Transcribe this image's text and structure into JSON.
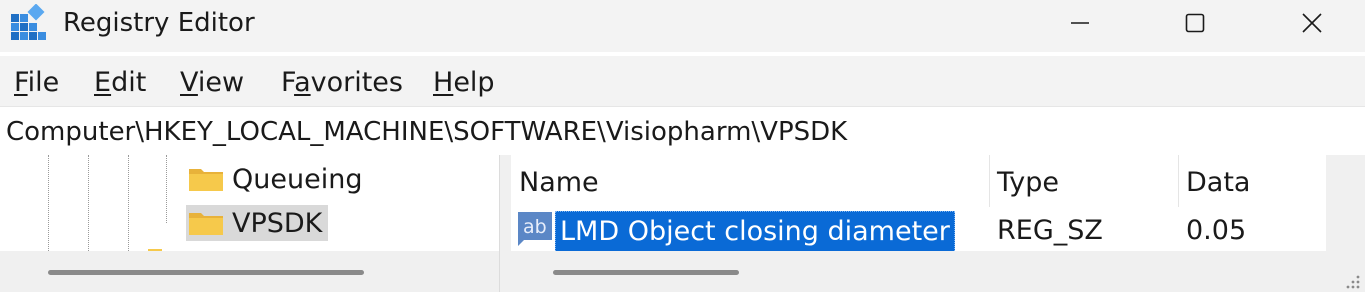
{
  "window": {
    "title": "Registry Editor",
    "icon": "registry-editor-icon"
  },
  "window_controls": {
    "minimize": "minimize-icon",
    "maximize": "maximize-icon",
    "close": "close-icon"
  },
  "menu": [
    {
      "accel": "F",
      "rest": "ile"
    },
    {
      "accel": "E",
      "rest": "dit"
    },
    {
      "accel": "V",
      "rest": "iew"
    },
    {
      "pre": "F",
      "accel": "a",
      "rest": "vorites"
    },
    {
      "accel": "H",
      "rest": "elp"
    }
  ],
  "address": "Computer\\HKEY_LOCAL_MACHINE\\SOFTWARE\\Visiopharm\\VPSDK",
  "tree": {
    "items": [
      {
        "label": "Queueing",
        "selected": false
      },
      {
        "label": "VPSDK",
        "selected": true
      }
    ]
  },
  "list": {
    "columns": [
      "Name",
      "Type",
      "Data"
    ],
    "rows": [
      {
        "icon": "string-value-icon",
        "icon_text": "ab",
        "name": "LMD Object closing diameter",
        "type": "REG_SZ",
        "data": "0.05",
        "selected": true
      }
    ]
  },
  "colors": {
    "selection": "#0a6ad6",
    "folder": "#f6c94b",
    "chrome": "#f3f3f3"
  }
}
